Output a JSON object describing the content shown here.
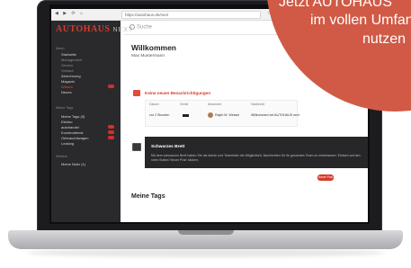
{
  "browser": {
    "url": "https://autohaus.de/next",
    "nav_glyphs": "◀ ▶ ⟳ ⌂",
    "tool_glyphs": "☆ ⋯ ◎ ≡"
  },
  "sidebar": {
    "logo": "AUTOHAUS",
    "logo_sub": "NEXT",
    "section1": "Menü",
    "items1": [
      "Startseite",
      "Management",
      "Service",
      "Verkauf",
      "Abrechnung",
      "Magazin",
      "Wissen",
      "Neues"
    ],
    "section2": "Meine Tags",
    "items2": [
      "Meine Tags (5)",
      "Elektro",
      "autohandel",
      "Kundendienst",
      "Gebrauchtwagen",
      "Leasing"
    ],
    "section3": "Weitere",
    "items3": [
      "Meine Notiz (1)"
    ]
  },
  "main": {
    "search_placeholder": "Suche",
    "welcome": "Willkommen",
    "user_name": "Max Mustermann",
    "notif_title": "Keine neuen Benachrichtigungen",
    "table_headers": [
      "Datum",
      "Gerät",
      "Absender",
      "Nachricht"
    ],
    "table_row": [
      "vor 2 Stunden",
      "",
      "Ralph M. Wessel",
      "Willkommen bei AUTOHAUS next"
    ],
    "dark_title": "Schwarzes Brett",
    "dark_text": "Mit dem schwarzen Brett haben Sie als Admin und Teamleiter die Möglichkeit, Nachrichten für Ihr gesamtes Team zu hinterlassen. Einfach auf den roten Button 'Neuer Post' klicken.",
    "new_post": "Neuer Post",
    "tags_title": "Meine Tags"
  },
  "promo": {
    "line1": "Jetzt AUTOHAUS",
    "line2": "im vollen Umfang",
    "line3": "nutzen"
  },
  "colors": {
    "accent": "#d63b2a",
    "promo_circle": "#d05a45",
    "sidebar_bg": "#2a2a2d"
  }
}
